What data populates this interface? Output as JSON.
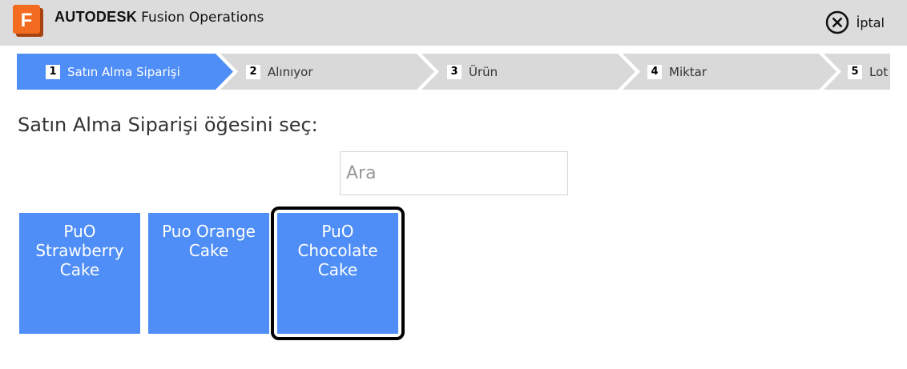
{
  "header": {
    "logo_letter": "F",
    "brand_name": "AUTODESK",
    "product_name": "Fusion Operations",
    "cancel_label": "İptal",
    "cancel_icon": "close-circle-icon"
  },
  "steps": [
    {
      "number": "1",
      "label": "Satın Alma Siparişi",
      "active": true
    },
    {
      "number": "2",
      "label": "Alınıyor",
      "active": false
    },
    {
      "number": "3",
      "label": "Ürün",
      "active": false
    },
    {
      "number": "4",
      "label": "Miktar",
      "active": false
    },
    {
      "number": "5",
      "label": "Lot",
      "active": false
    }
  ],
  "prompt": "Satın Alma Siparişi öğesini seç:",
  "search": {
    "value": "",
    "placeholder": "Ara"
  },
  "items": [
    {
      "label": "PuO Strawberry Cake",
      "selected": false
    },
    {
      "label": "Puo Orange Cake",
      "selected": false
    },
    {
      "label": "PuO Chocolate Cake",
      "selected": true
    }
  ],
  "colors": {
    "header_bg": "#dcdcdc",
    "step_active": "#4f8ef7",
    "step_inactive": "#d9d9d9",
    "tile_bg": "#4f8ef7",
    "logo_orange": "#f26b21"
  }
}
